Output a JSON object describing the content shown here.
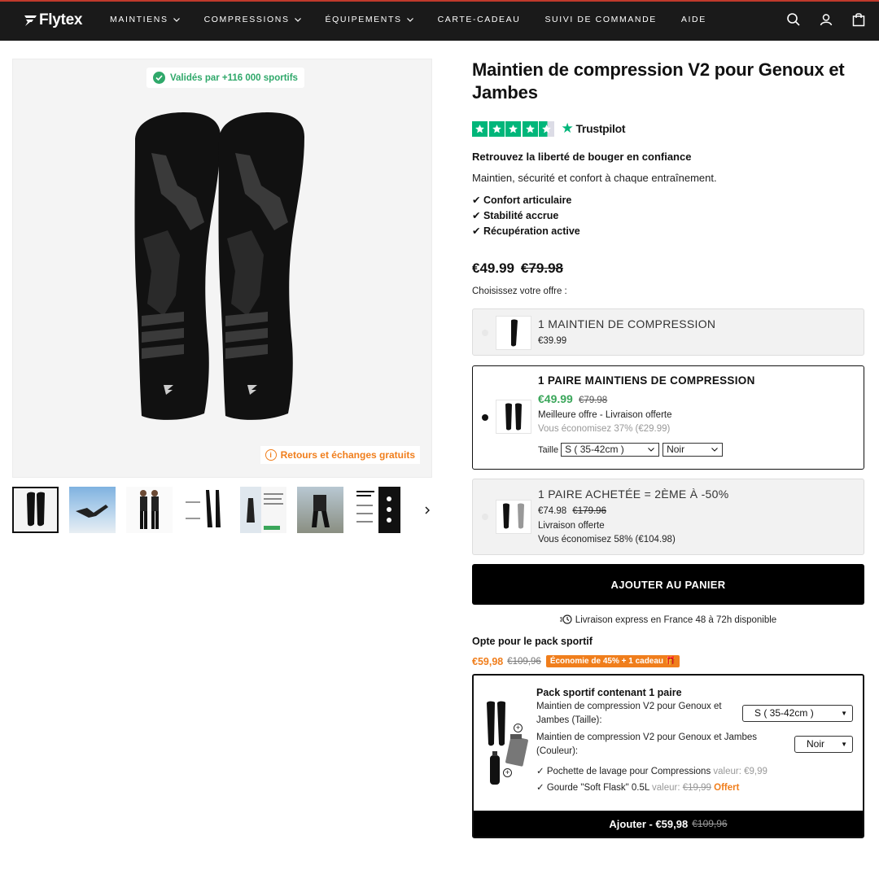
{
  "nav": {
    "logo": "Flytex",
    "items": [
      {
        "label": "MAINTIENS",
        "has_dropdown": true
      },
      {
        "label": "COMPRESSIONS",
        "has_dropdown": true
      },
      {
        "label": "ÉQUIPEMENTS",
        "has_dropdown": true
      },
      {
        "label": "CARTE-CADEAU",
        "has_dropdown": false
      },
      {
        "label": "SUIVI DE COMMANDE",
        "has_dropdown": false
      },
      {
        "label": "AIDE",
        "has_dropdown": false
      }
    ]
  },
  "gallery": {
    "badge_valid": "Validés par +116 000 sportifs",
    "badge_returns": "Retours et échanges gratuits",
    "thumbnail_count": 7
  },
  "product": {
    "title": "Maintien de compression V2 pour Genoux et Jambes",
    "trustpilot": "Trustpilot",
    "tagline": "Retrouvez la liberté de bouger en confiance",
    "subtagline": "Maintien, sécurité et confort à chaque entraînement.",
    "features": [
      "✔ Confort articulaire",
      "✔ Stabilité accrue",
      "✔ Récupération active"
    ],
    "price_now": "€49.99",
    "price_old": "€79.98",
    "choose_label": "Choisissez votre offre :"
  },
  "offers": [
    {
      "title": "1 MAINTIEN DE COMPRESSION",
      "price": "€39.99"
    },
    {
      "title": "1 PAIRE MAINTIENS DE COMPRESSION",
      "price": "€49.99",
      "price_old": "€79.98",
      "line1": "Meilleure offre - Livraison offerte",
      "line2": "Vous économisez 37% (€29.99)",
      "size_label": "Taille",
      "size_value": "S ( 35-42cm )",
      "color_value": "Noir"
    },
    {
      "title": "1 PAIRE ACHETÉE = 2ÈME À -50%",
      "price": "€74.98",
      "price_old": "€179.96",
      "line1": "Livraison offerte",
      "line2": "Vous économisez 58% (€104.98)"
    }
  ],
  "cta": "AJOUTER AU PANIER",
  "delivery": "Livraison express en France 48 à 72h disponible",
  "pack": {
    "heading": "Opte pour le pack sportif",
    "price": "€59,98",
    "price_old": "€109,96",
    "tag": "Économie de 45% + 1 cadeau 🎁",
    "title": "Pack sportif contenant 1 paire",
    "line_size": "Maintien de compression V2 pour Genoux et Jambes (Taille):",
    "size_value": "S ( 35-42cm )",
    "line_color": "Maintien de compression V2 pour Genoux et Jambes (Couleur):",
    "color_value": "Noir",
    "item1": "✓ Pochette de lavage pour Compressions",
    "item1_value": "valeur: €9,99",
    "item2": "✓ Gourde \"Soft Flask\" 0.5L",
    "item2_value_label": "valeur:",
    "item2_value": "€19,99",
    "item2_offer": "Offert",
    "footer": "Ajouter - €59,98",
    "footer_old": "€109,96"
  },
  "colors": {
    "accent_orange": "#f07e1c",
    "trust_green": "#00b67a",
    "price_green": "#3aa65a",
    "nav_bg": "#1a1a1a"
  }
}
